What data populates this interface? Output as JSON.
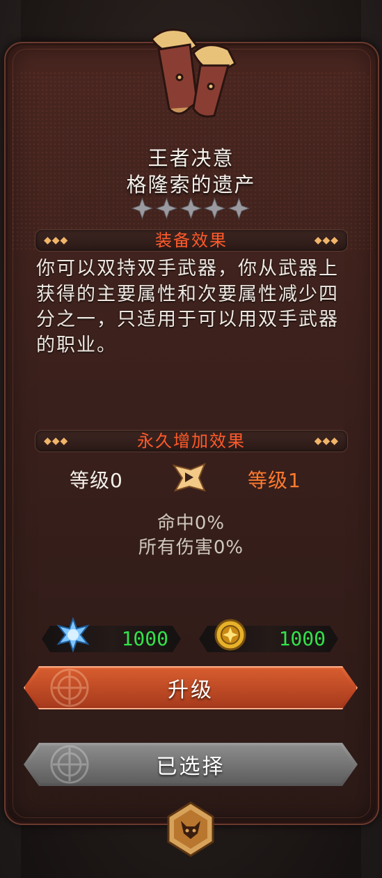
{
  "item": {
    "name_line1": "王者决意",
    "name_line2": "格隆索的遗产",
    "art_icon": "leather-gauntlets-icon",
    "star_count": 5,
    "stars_filled": 0
  },
  "equip_effect": {
    "title": "装备效果",
    "description": "你可以双持双手武器，你从武器上获得的主要属性和次要属性减少四分之一，只适用于可以用双手武器的职业。"
  },
  "permanent_bonus": {
    "title": "永久增加效果",
    "current_level": "等级0",
    "next_level": "等级1",
    "arrow_icon": "upgrade-arrow-icon",
    "stats": [
      "命中0%",
      "所有伤害0%"
    ]
  },
  "costs": [
    {
      "icon": "blue-crystal-icon",
      "value": "1000"
    },
    {
      "icon": "gold-coin-icon",
      "value": "1000"
    }
  ],
  "buttons": {
    "upgrade_label": "升级",
    "selected_label": "已选择"
  },
  "colors": {
    "section_title": "#ff5a2a",
    "next_level": "#ff7a2e",
    "cost_text": "#33e24a",
    "upgrade_button": "#c74a24",
    "selected_button": "#777777"
  },
  "bottom_icon": "demon-emblem-icon"
}
